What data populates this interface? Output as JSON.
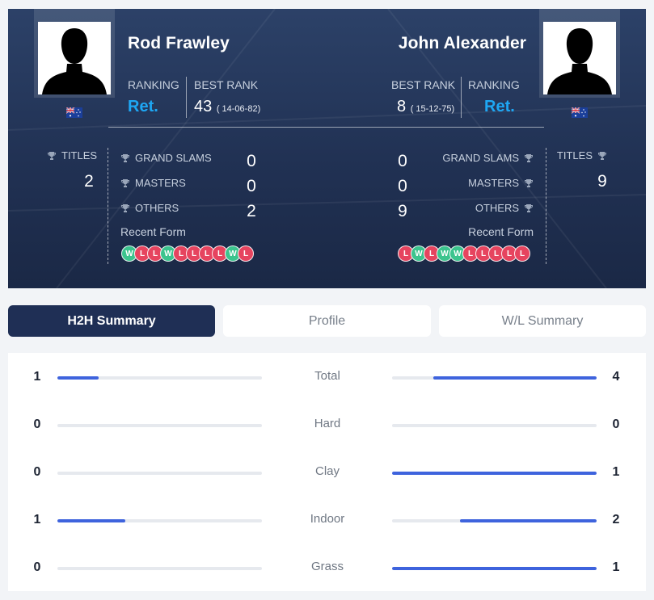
{
  "player1": {
    "name": "Rod Frawley",
    "ranking_label": "RANKING",
    "ranking": "Ret.",
    "best_rank_label": "BEST RANK",
    "best_rank": "43",
    "best_rank_date": "( 14-06-82)",
    "titles_label": "TITLES",
    "titles": "2",
    "grand_slams_label": "GRAND SLAMS",
    "grand_slams": "0",
    "masters_label": "MASTERS",
    "masters": "0",
    "others_label": "OTHERS",
    "others": "2",
    "recent_form_label": "Recent Form",
    "recent_form": [
      "W",
      "L",
      "L",
      "W",
      "L",
      "L",
      "L",
      "L",
      "W",
      "L"
    ],
    "flag": "australia-flag"
  },
  "player2": {
    "name": "John Alexander",
    "ranking_label": "RANKING",
    "ranking": "Ret.",
    "best_rank_label": "BEST RANK",
    "best_rank": "8",
    "best_rank_date": "( 15-12-75)",
    "titles_label": "TITLES",
    "titles": "9",
    "grand_slams_label": "GRAND SLAMS",
    "grand_slams": "0",
    "masters_label": "MASTERS",
    "masters": "0",
    "others_label": "OTHERS",
    "others": "9",
    "recent_form_label": "Recent Form",
    "recent_form": [
      "L",
      "W",
      "L",
      "W",
      "W",
      "L",
      "L",
      "L",
      "L",
      "L"
    ],
    "flag": "australia-flag"
  },
  "tabs": [
    {
      "label": "H2H Summary",
      "active": true
    },
    {
      "label": "Profile",
      "active": false
    },
    {
      "label": "W/L Summary",
      "active": false
    }
  ],
  "h2h": [
    {
      "label": "Total",
      "p1": 1,
      "p2": 4
    },
    {
      "label": "Hard",
      "p1": 0,
      "p2": 0
    },
    {
      "label": "Clay",
      "p1": 0,
      "p2": 1
    },
    {
      "label": "Indoor",
      "p1": 1,
      "p2": 2
    },
    {
      "label": "Grass",
      "p1": 0,
      "p2": 1
    }
  ],
  "colors": {
    "header_bg": "#1f3159",
    "ranking_accent": "#1ea7f4",
    "win": "#3cc48e",
    "loss": "#e6445f",
    "bar": "#3e63dd",
    "active_tab": "#1f2f55"
  }
}
